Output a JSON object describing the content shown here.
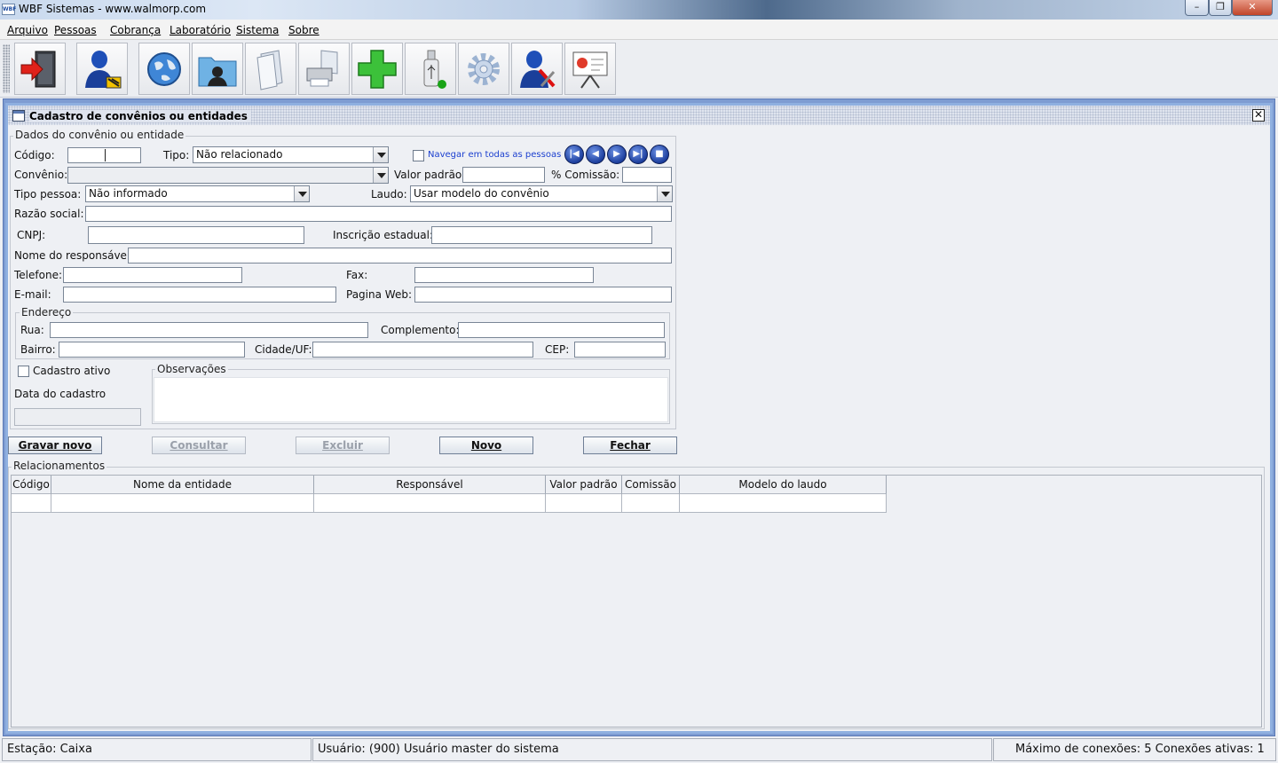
{
  "window": {
    "title": "WBF Sistemas - www.walmorp.com",
    "app_icon": "WBF"
  },
  "menu": [
    "Arquivo",
    "Pessoas",
    "Cobrança",
    "Laboratório",
    "Sistema",
    "Sobre"
  ],
  "toolbar_icons": [
    "exit-door-icon",
    "user-person-icon",
    "globe-icon",
    "contact-folder-icon",
    "documents-icon",
    "printer-icon",
    "green-plus-icon",
    "usb-drive-icon",
    "settings-gear-icon",
    "user-tools-icon",
    "presentation-board-icon"
  ],
  "frame": {
    "title": "Cadastro de convênios ou entidades"
  },
  "form": {
    "group_title": "Dados do convênio ou entidade",
    "codigo_label": "Código:",
    "tipo_label": "Tipo:",
    "tipo_value": "Não relacionado",
    "navegar_label": "Navegar em todas as pessoas",
    "convenio_label": "Convênio:",
    "valor_padrao_label": "Valor padrão:",
    "comissao_label": "% Comissão:",
    "tipo_pessoa_label": "Tipo pessoa:",
    "tipo_pessoa_value": "Não informado",
    "laudo_label": "Laudo:",
    "laudo_value": "Usar modelo do convênio",
    "razao_label": "Razão social:",
    "cnpj_label": "CNPJ:",
    "ie_label": "Inscrição estadual:",
    "responsavel_label": "Nome do responsável:",
    "telefone_label": "Telefone:",
    "fax_label": "Fax:",
    "email_label": "E-mail:",
    "web_label": "Pagina Web:",
    "endereco_title": "Endereço",
    "rua_label": "Rua:",
    "complemento_label": "Complemento:",
    "bairro_label": "Bairro:",
    "cidade_label": "Cidade/UF:",
    "cep_label": "CEP:",
    "ativo_label": "Cadastro ativo",
    "data_label": "Data do cadastro",
    "obs_title": "Observações"
  },
  "buttons": {
    "gravar": "Gravar novo",
    "consultar": "Consultar",
    "excluir": "Excluir",
    "novo": "Novo",
    "fechar": "Fechar"
  },
  "relacionamentos": {
    "title": "Relacionamentos",
    "columns": [
      "Código",
      "Nome da entidade",
      "Responsável",
      "Valor padrão",
      "Comissão",
      "Modelo do laudo"
    ]
  },
  "status": {
    "estacao": "Estação: Caixa",
    "usuario": "Usuário: (900) Usuário master do sistema",
    "conexoes": "Máximo de conexões: 5 Conexões ativas: 1"
  }
}
